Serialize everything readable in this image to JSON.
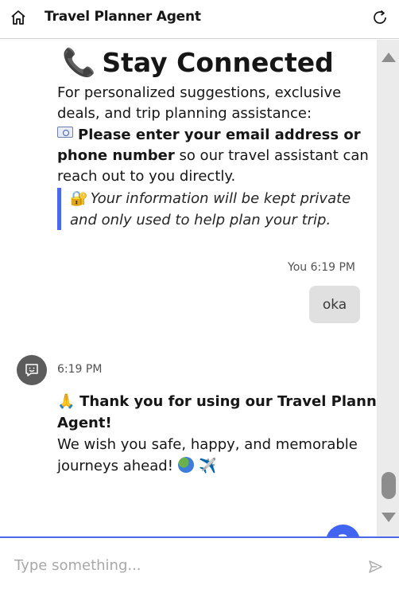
{
  "header": {
    "title": "Travel Planner Agent",
    "home_icon": "home-icon",
    "refresh_icon": "refresh-icon"
  },
  "messages": {
    "bot_message_1": {
      "title_emoji": "📞",
      "title": "Stay Connected",
      "intro_line1": "For personalized suggestions, exclusive",
      "intro_line2": "deals, and trip planning assistance:",
      "request_bold_1": "Please enter your email address or",
      "request_bold_2": "phone number",
      "request_rest_1": " so our travel assistant can",
      "request_rest_2": "reach out to you directly.",
      "privacy_emoji": "🔐",
      "privacy_line1": "Your information will be kept private",
      "privacy_line2": "and only used to help plan your trip."
    },
    "user_message": {
      "meta": "You 6:19 PM",
      "text": "oka"
    },
    "bot_message_2": {
      "time": "6:19 PM",
      "thanks_emoji": "🙏",
      "thanks_line1": "Thank you for using our Travel Planner",
      "thanks_line2": "Agent!",
      "wish_line1": "We wish you safe, happy, and memorable",
      "wish_line2": "journeys ahead!",
      "plane_emoji": "✈️"
    }
  },
  "help_button": {
    "label": "?"
  },
  "composer": {
    "placeholder": "Type something...",
    "value": ""
  },
  "colors": {
    "accent": "#4165f0",
    "quote_border": "#4a68e8",
    "user_bubble": "#e0e0e0",
    "avatar": "#5c5c5c"
  }
}
